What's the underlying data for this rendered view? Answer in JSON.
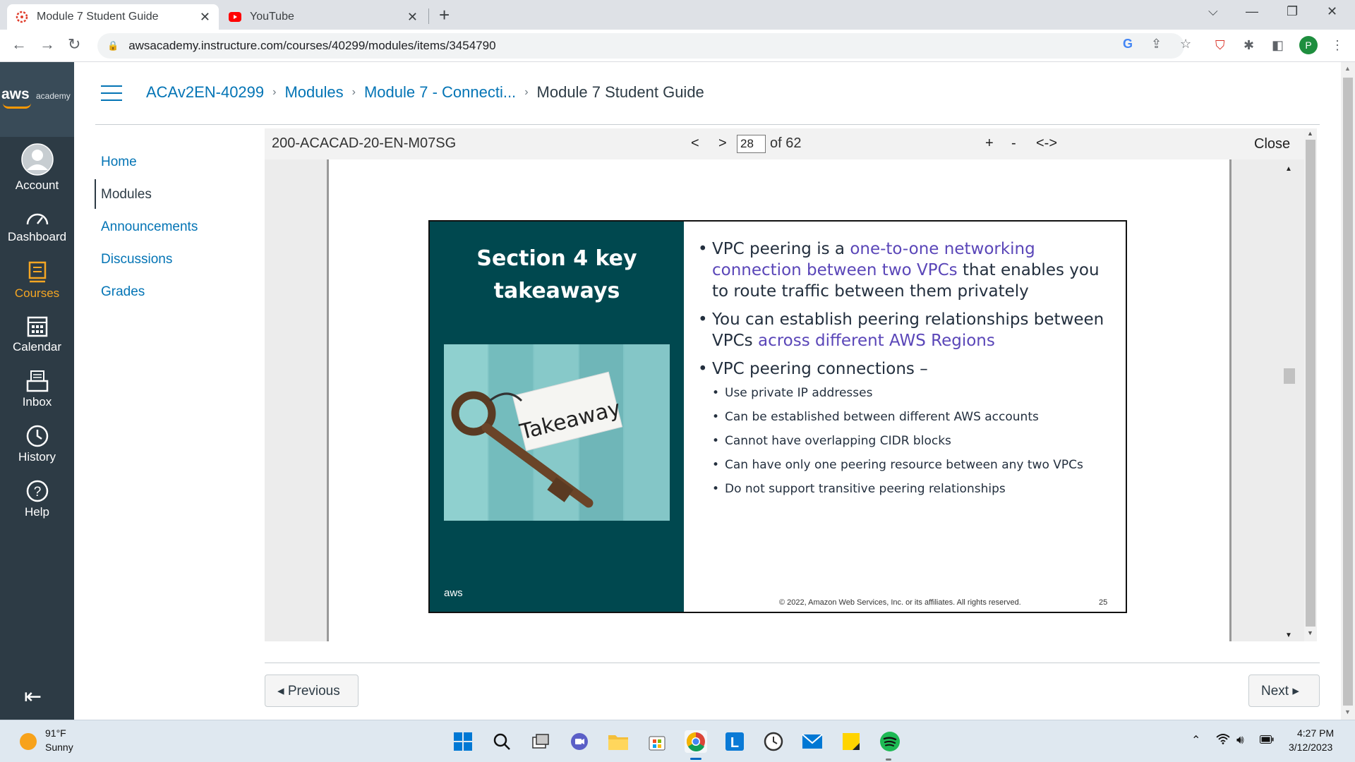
{
  "browser": {
    "tabs": [
      {
        "title": "Module 7 Student Guide",
        "active": true
      },
      {
        "title": "YouTube",
        "active": false
      }
    ],
    "url": "awsacademy.instructure.com/courses/40299/modules/items/3454790",
    "profile_initial": "P"
  },
  "global_nav": {
    "logo_main": "aws",
    "logo_sub": "academy",
    "items": [
      {
        "label": "Account",
        "icon": "account-icon"
      },
      {
        "label": "Dashboard",
        "icon": "dashboard-icon"
      },
      {
        "label": "Courses",
        "icon": "courses-icon",
        "active": true
      },
      {
        "label": "Calendar",
        "icon": "calendar-icon"
      },
      {
        "label": "Inbox",
        "icon": "inbox-icon"
      },
      {
        "label": "History",
        "icon": "history-icon"
      },
      {
        "label": "Help",
        "icon": "help-icon"
      }
    ]
  },
  "breadcrumb": {
    "items": [
      "ACAv2EN-40299",
      "Modules",
      "Module 7 - Connecti..."
    ],
    "current": "Module 7 Student Guide"
  },
  "course_nav": {
    "items": [
      "Home",
      "Modules",
      "Announcements",
      "Discussions",
      "Grades"
    ],
    "active": "Modules"
  },
  "viewer": {
    "doc_name": "200-ACACAD-20-EN-M07SG",
    "prev": "<",
    "next": ">",
    "page": "28",
    "of_label": "of 62",
    "zoom_in": "+",
    "zoom_out": "-",
    "fit": "<->",
    "close": "Close"
  },
  "slide": {
    "title_line1": "Section 4 key",
    "title_line2": "takeaways",
    "image_tag": "Takeaway",
    "aws_logo": "aws",
    "bullet1_pre": "VPC peering is a ",
    "bullet1_hl": "one-to-one networking connection between two VPCs",
    "bullet1_post": " that enables you to route traffic between them privately",
    "bullet2_pre": "You can establish peering relationships between VPCs ",
    "bullet2_hl": "across different AWS Regions",
    "bullet3": "VPC peering connections –",
    "sub_bullets": [
      "Use private IP addresses",
      "Can be established between different AWS accounts",
      "Cannot have overlapping CIDR blocks",
      "Can have only one peering resource between any two VPCs",
      "Do not support transitive peering relationships"
    ],
    "copyright": "© 2022, Amazon Web Services, Inc. or its affiliates. All rights reserved.",
    "number": "25"
  },
  "pager": {
    "previous": "◂ Previous",
    "next": "Next ▸"
  },
  "taskbar": {
    "weather_temp": "91°F",
    "weather_desc": "Sunny",
    "time": "4:27 PM",
    "date": "3/12/2023"
  },
  "colors": {
    "canvas_nav": "#2d3b45",
    "link": "#0374b5",
    "slide_teal": "#00484f",
    "slide_highlight": "#5a46b8",
    "courses_active": "#f5a623"
  }
}
